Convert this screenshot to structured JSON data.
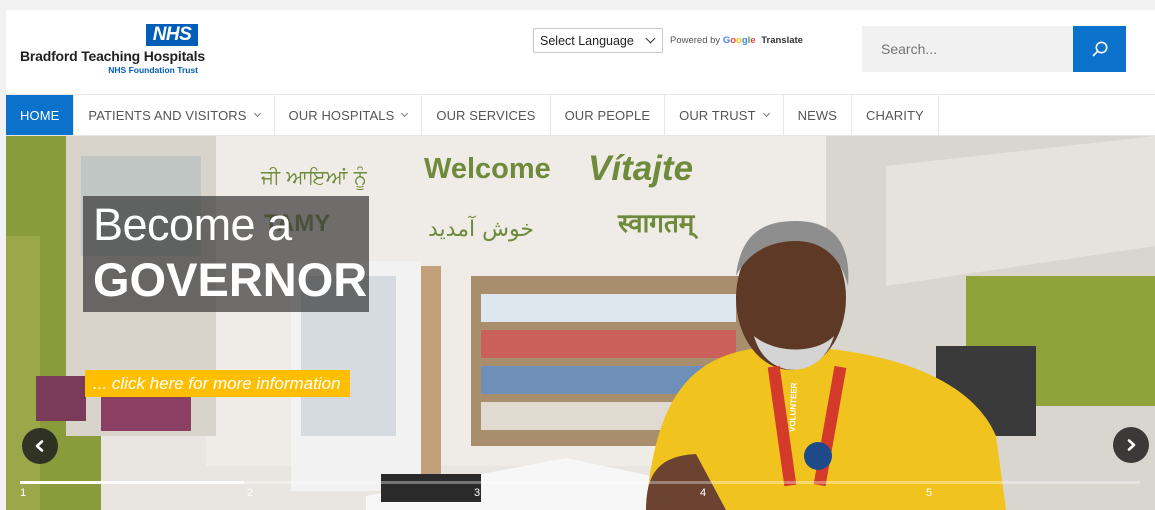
{
  "logo": {
    "badge": "NHS",
    "name": "Bradford Teaching Hospitals",
    "trust": "NHS Foundation Trust"
  },
  "translate": {
    "select_label": "Select Language",
    "powered_by": "Powered by",
    "google": [
      "G",
      "o",
      "o",
      "g",
      "l",
      "e"
    ],
    "translate_word": "Translate"
  },
  "search": {
    "placeholder": "Search..."
  },
  "nav": {
    "items": [
      {
        "label": "HOME",
        "has_dropdown": false,
        "active": true
      },
      {
        "label": "PATIENTS AND VISITORS",
        "has_dropdown": true
      },
      {
        "label": "OUR HOSPITALS",
        "has_dropdown": true
      },
      {
        "label": "OUR SERVICES",
        "has_dropdown": false
      },
      {
        "label": "OUR PEOPLE",
        "has_dropdown": false
      },
      {
        "label": "OUR TRUST",
        "has_dropdown": true
      },
      {
        "label": "NEWS",
        "has_dropdown": false
      },
      {
        "label": "CHARITY",
        "has_dropdown": false
      }
    ]
  },
  "hero": {
    "headline_line1": "Become a",
    "headline_line2": "GOVERNOR",
    "cta": "... click here for more information",
    "wall_text": {
      "welcome": "Welcome",
      "vitajte": "Vítajte",
      "punjabi": "ਜੀ ਆਇਆਂ ਨੂੰ",
      "urdu": "خوش آمدید",
      "hindi": "स्वागतम्",
      "partial": "TAMY"
    },
    "lanyard_text": "VOLUNTEER",
    "slides": [
      "1",
      "2",
      "3",
      "4",
      "5"
    ],
    "progress_fraction": 0.2
  },
  "colors": {
    "nhs_blue": "#005eb8",
    "accent_blue": "#0a72ca",
    "cta_yellow": "#ffbf00",
    "wall_green": "#6f8a3a"
  }
}
